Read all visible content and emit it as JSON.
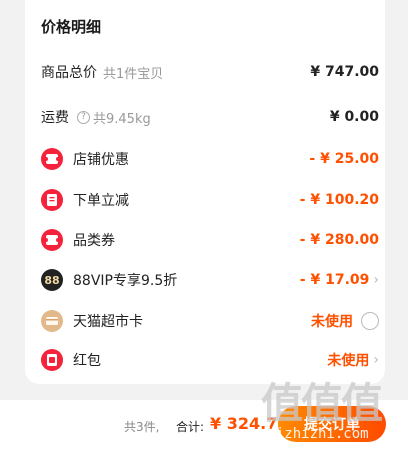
{
  "price_details": {
    "title": "价格明细",
    "goods_total": {
      "label": "商品总价",
      "sub": "共1件宝贝",
      "value": "¥ 747.00"
    },
    "shipping": {
      "label": "运费",
      "sub": "共9.45kg",
      "value": "¥ 0.00"
    },
    "items": [
      {
        "label": "店铺优惠",
        "value": "- ¥ 25.00",
        "icon": "coupon-icon"
      },
      {
        "label": "下单立减",
        "value": "- ¥ 100.20",
        "icon": "discount-icon"
      },
      {
        "label": "品类券",
        "value": "- ¥ 280.00",
        "icon": "category-coupon-icon"
      },
      {
        "label": "88VIP专享9.5折",
        "value": "- ¥ 17.09",
        "icon": "vip88-icon",
        "icon_text": "88"
      },
      {
        "label": "天猫超市卡",
        "value": "未使用",
        "icon": "supermarket-card-icon"
      },
      {
        "label": "红包",
        "value": "未使用",
        "icon": "red-packet-icon"
      }
    ]
  },
  "footer": {
    "count": "共3件,",
    "total_label": "合计:",
    "total_value": "¥ 324.7",
    "submit_label": "提交订单"
  },
  "watermark": {
    "chars": "值值值",
    "text": "zhizhizhi.com"
  },
  "colors": {
    "accent": "#ff5000",
    "icon_red": "#f5223b"
  }
}
